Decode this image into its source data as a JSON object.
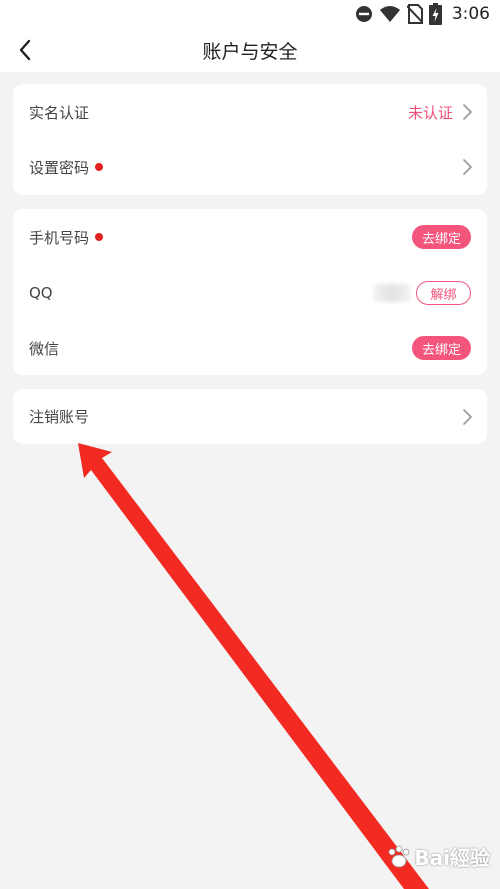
{
  "status_bar": {
    "time": "3:06",
    "icons": [
      "do-not-disturb-icon",
      "wifi-icon",
      "no-sim-icon",
      "battery-charging-icon"
    ]
  },
  "header": {
    "back_icon": "chevron-left-icon",
    "title": "账户与安全"
  },
  "cards": {
    "identity": {
      "real_name": {
        "label": "实名认证",
        "status": "未认证",
        "has_dot": false
      },
      "set_password": {
        "label": "设置密码",
        "has_dot": true
      }
    },
    "bindings": {
      "phone": {
        "label": "手机号码",
        "action": "去绑定",
        "has_dot": true
      },
      "qq": {
        "label": "QQ",
        "action": "解绑"
      },
      "wechat": {
        "label": "微信",
        "action": "去绑定"
      }
    },
    "cancel_account": {
      "label": "注销账号"
    }
  },
  "colors": {
    "accent": "#f3557c",
    "status_text": "#f04f78",
    "dot": "#e62020",
    "annotation_arrow": "#f22a22",
    "background": "#f4f3f4"
  },
  "watermark": {
    "text": "Bai經验"
  }
}
